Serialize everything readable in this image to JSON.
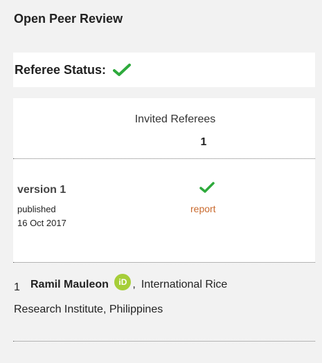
{
  "panel": {
    "title": "Open Peer Review",
    "referee_status_label": "Referee Status:",
    "status_icon": "green-check-icon",
    "accent_color": "#2eaa3c",
    "link_color": "#c96a2e"
  },
  "referees_table": {
    "invited_label": "Invited Referees",
    "referee_count": "1",
    "version": {
      "label": "version 1",
      "published_label": "published",
      "published_date": "16 Oct 2017",
      "report_status_icon": "green-check-icon",
      "report_link": "report"
    }
  },
  "referees": [
    {
      "number": "1",
      "name": "Ramil Mauleon",
      "orcid_icon": "orcid-icon",
      "orcid_text": "iD",
      "affiliation_line1": "International Rice",
      "affiliation_line2": "Research Institute, Philippines"
    }
  ]
}
